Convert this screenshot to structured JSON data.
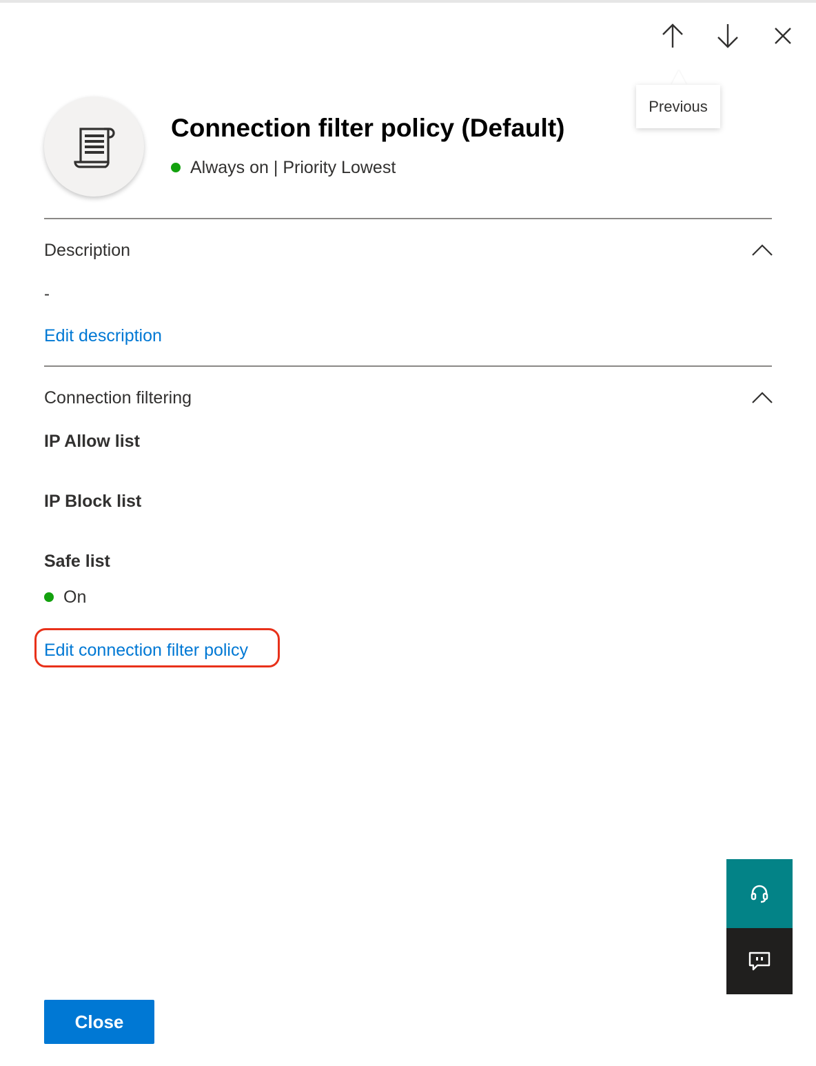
{
  "nav": {
    "up_icon": "arrow-up-icon",
    "down_icon": "arrow-down-icon",
    "close_icon": "close-icon",
    "tooltip": "Previous"
  },
  "header": {
    "icon": "scroll-policy-icon",
    "title": "Connection filter policy (Default)",
    "status_dot_color": "#13a10e",
    "status_text": "Always on | Priority Lowest"
  },
  "description": {
    "title": "Description",
    "value": "-",
    "edit_link": "Edit description"
  },
  "connection_filtering": {
    "title": "Connection filtering",
    "ip_allow_label": "IP Allow list",
    "ip_block_label": "IP Block list",
    "safe_list_label": "Safe list",
    "safe_list_value": "On",
    "edit_link": "Edit connection filter policy"
  },
  "side_actions": {
    "help_icon": "headset-icon",
    "help_color": "#038387",
    "feedback_icon": "feedback-chat-icon",
    "feedback_color": "#201f1e"
  },
  "footer": {
    "close_label": "Close",
    "accent_color": "#0078d4"
  }
}
